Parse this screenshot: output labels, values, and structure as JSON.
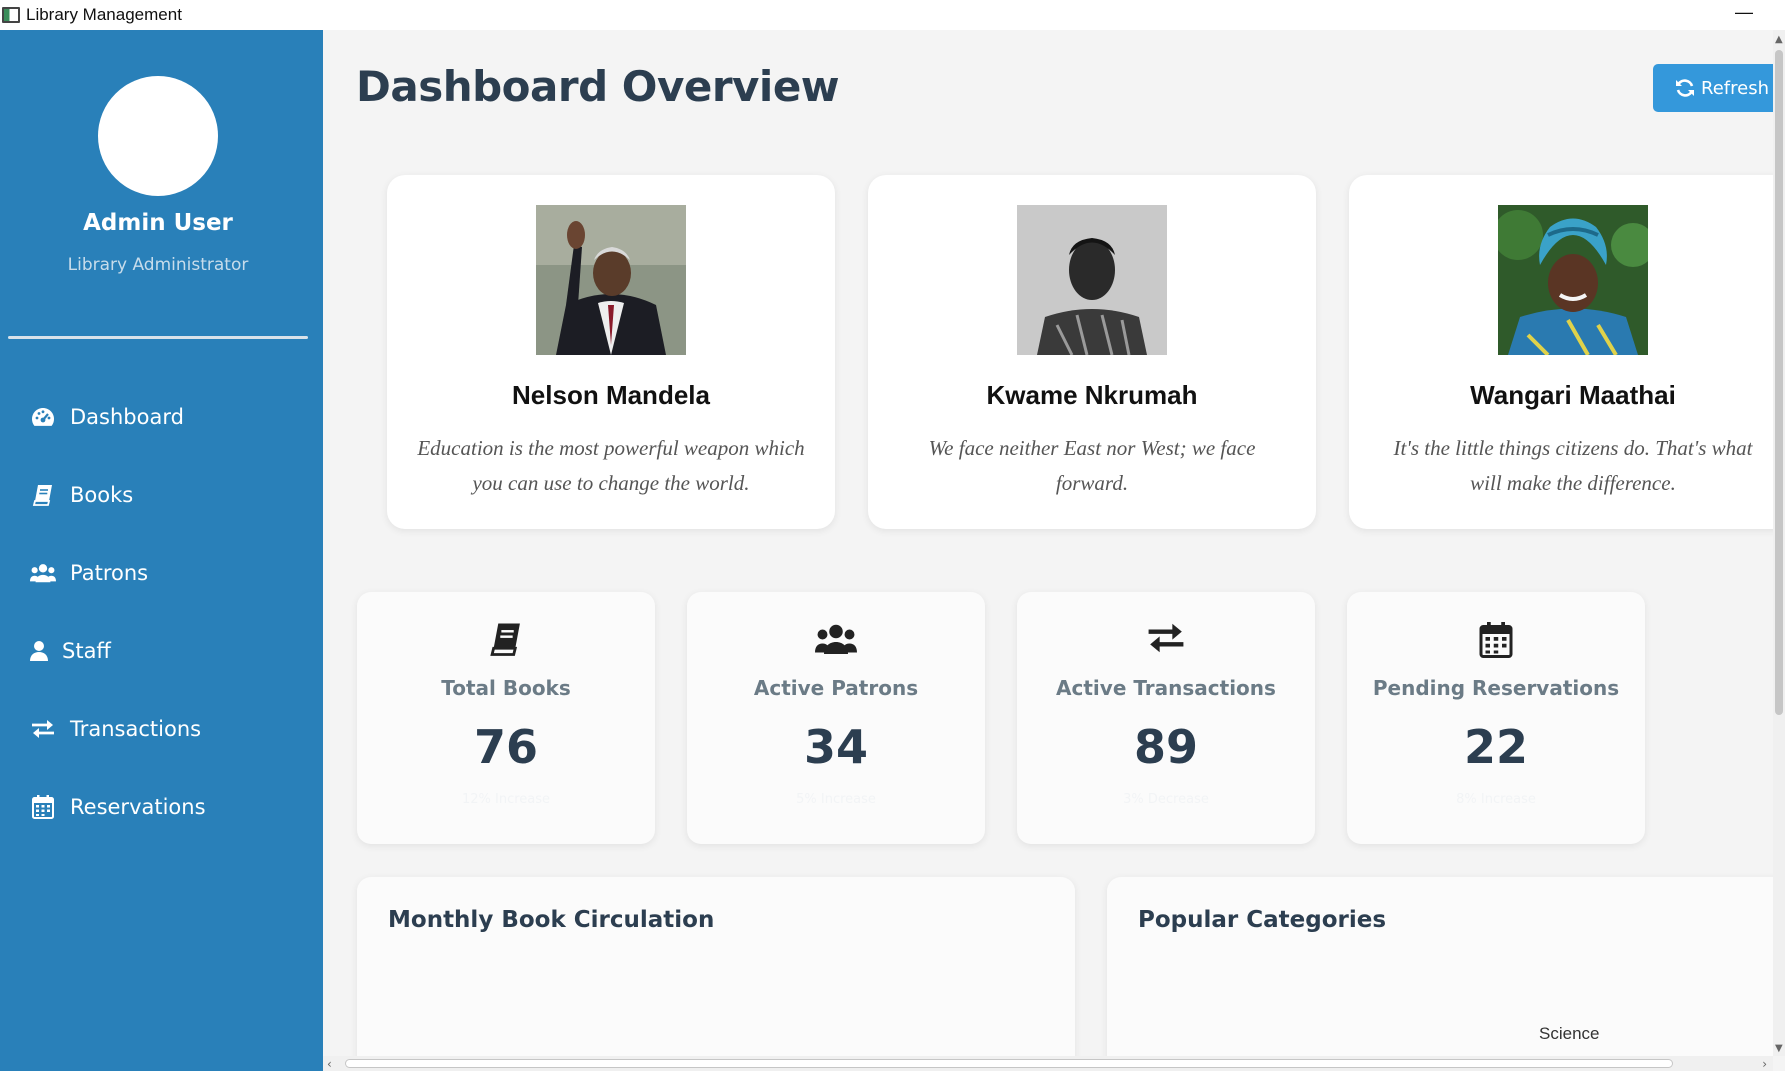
{
  "window": {
    "title": "Library Management",
    "minimize_glyph": "—"
  },
  "sidebar": {
    "user_name": "Admin User",
    "user_role": "Library Administrator",
    "items": [
      {
        "label": "Dashboard",
        "icon": "tachometer-icon"
      },
      {
        "label": "Books",
        "icon": "book-icon"
      },
      {
        "label": "Patrons",
        "icon": "users-icon"
      },
      {
        "label": "Staff",
        "icon": "user-icon"
      },
      {
        "label": "Transactions",
        "icon": "exchange-icon"
      },
      {
        "label": "Reservations",
        "icon": "calendar-icon"
      }
    ]
  },
  "header": {
    "title": "Dashboard Overview",
    "refresh_label": "Refresh D"
  },
  "leaders": [
    {
      "name": "Nelson Mandela",
      "quote": "Education is the most powerful weapon which you can use to change the world."
    },
    {
      "name": "Kwame Nkrumah",
      "quote": "We face neither East nor West; we face forward."
    },
    {
      "name": "Wangari Maathai",
      "quote": "It's the little things citizens do. That's what will make the difference."
    }
  ],
  "stats": [
    {
      "label": "Total Books",
      "value": "76",
      "icon": "book-icon",
      "subtext": "12% Increase"
    },
    {
      "label": "Active Patrons",
      "value": "34",
      "icon": "users-icon",
      "subtext": "5% Increase"
    },
    {
      "label": "Active Transactions",
      "value": "89",
      "icon": "exchange-icon",
      "subtext": "3% Decrease"
    },
    {
      "label": "Pending Reservations",
      "value": "22",
      "icon": "calendar-icon",
      "subtext": "8% Increase"
    }
  ],
  "charts": {
    "monthly_title": "Monthly Book Circulation",
    "categories_title": "Popular Categories",
    "categories_visible_label": "Science"
  },
  "colors": {
    "sidebar": "#2980b9",
    "accent": "#3498db",
    "title_text": "#2c3e50",
    "bar_orange": "#f05a28"
  }
}
